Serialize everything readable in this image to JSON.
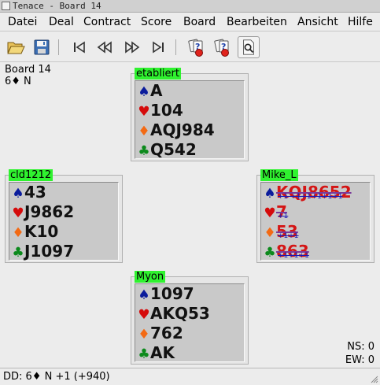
{
  "window": {
    "title": "Tenace - Board 14"
  },
  "menu": [
    "Datei",
    "Deal",
    "Contract",
    "Score",
    "Board",
    "Bearbeiten",
    "Ansicht",
    "Hilfe"
  ],
  "info": {
    "board": "Board 14",
    "contract": "6♦ N"
  },
  "players": {
    "north": {
      "name": "etabliert",
      "spades": "A",
      "hearts": "104",
      "diamonds": "AQJ984",
      "clubs": "Q542"
    },
    "west": {
      "name": "cld1212",
      "spades": "43",
      "hearts": "J9862",
      "diamonds": "K10",
      "clubs": "J1097"
    },
    "east": {
      "name": "Mike_L",
      "spades": "KQJ8652",
      "hearts": "7",
      "diamonds": "53",
      "clubs": "863",
      "marks": {
        "spades": "+1 +1+1+1+1+1",
        "hearts": "+1",
        "diamonds": "+1+1",
        "clubs": "+1+1+1"
      }
    },
    "south": {
      "name": "Myon",
      "spades": "1097",
      "hearts": "AKQ53",
      "diamonds": "762",
      "clubs": "AK"
    }
  },
  "suits": {
    "spades": "♠",
    "hearts": "♥",
    "diamonds": "♦",
    "clubs": "♣"
  },
  "score": {
    "ns": "NS: 0",
    "ew": "EW: 0"
  },
  "status": "DD: 6♦ N +1 (+940)",
  "colors": {
    "name_badge": "#2ff22f",
    "spade": "#0b1c9c",
    "heart": "#d50b0b",
    "diamond": "#f36a14",
    "club": "#0c8a1c",
    "played": "#d41515"
  }
}
